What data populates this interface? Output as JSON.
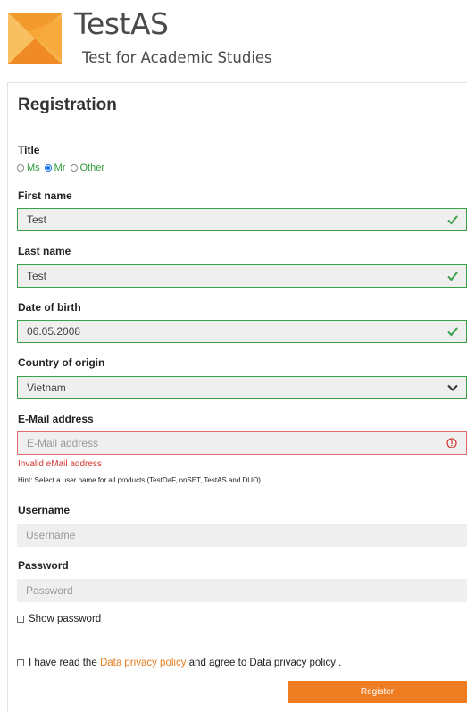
{
  "brand": {
    "title": "TestAS",
    "subtitle": "Test for Academic Studies",
    "colors": {
      "orange": "#f29a2e",
      "text": "#4a4a4a"
    }
  },
  "form": {
    "heading": "Registration",
    "title": {
      "label": "Title",
      "options": [
        "Ms",
        "Mr",
        "Other"
      ],
      "selected": "Mr"
    },
    "first_name": {
      "label": "First name",
      "value": "Test",
      "status": "valid"
    },
    "last_name": {
      "label": "Last name",
      "value": "Test",
      "status": "valid"
    },
    "dob": {
      "label": "Date of birth",
      "value": "06.05.2008",
      "status": "valid"
    },
    "country": {
      "label": "Country of origin",
      "value": "Vietnam",
      "status": "valid"
    },
    "email": {
      "label": "E-Mail address",
      "placeholder": "E-Mail address",
      "status": "invalid",
      "error": "Invalid eMail address",
      "hint": "Hint: Select a user name for all products (TestDaF, onSET, TestAS and DUO)."
    },
    "username": {
      "label": "Username",
      "placeholder": "Username"
    },
    "password": {
      "label": "Password",
      "placeholder": "Password"
    },
    "show_password": {
      "label": "Show password",
      "checked": false
    },
    "privacy": {
      "prefix": "I have read the",
      "link": "Data privacy policy",
      "suffix": "and agree to Data privacy policy .",
      "checked": false
    },
    "register_label": "Register"
  },
  "colors": {
    "valid": "#3aa04a",
    "invalid": "#e06a6a",
    "button": "#ee7d22",
    "link": "#e57c1f"
  }
}
